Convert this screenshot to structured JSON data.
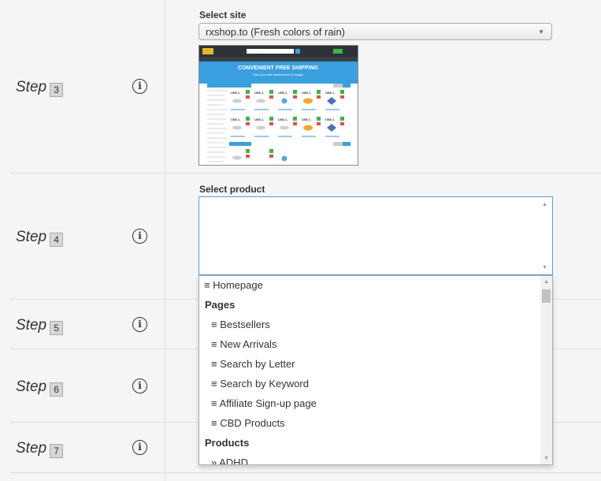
{
  "steps": [
    {
      "label": "Step",
      "number": "3"
    },
    {
      "label": "Step",
      "number": "4"
    },
    {
      "label": "Step",
      "number": "5"
    },
    {
      "label": "Step",
      "number": "6"
    },
    {
      "label": "Step",
      "number": "7"
    }
  ],
  "info_glyph": "i",
  "site": {
    "label": "Select site",
    "selected": "rxshop.to (Fresh colors of rain)",
    "arrow": "▼"
  },
  "preview": {
    "banner_title": "CONVENIENT FREE SHIPPING",
    "banner_sub": "Have your order delivered free of charge!",
    "price": "US$ 1.",
    "colors": {
      "header": "#2e3338",
      "banner": "#3aa0e0",
      "accent": "#3aa0e0",
      "green": "#3cb44a",
      "badge": "#d9534f"
    }
  },
  "product": {
    "label": "Select product",
    "scroll_up": "▲",
    "scroll_down": "▼"
  },
  "dropdown": {
    "items": [
      {
        "text": "≡ Homepage",
        "type": "item"
      },
      {
        "text": "Pages",
        "type": "group"
      },
      {
        "text": "≡ Bestsellers",
        "type": "sub"
      },
      {
        "text": "≡ New Arrivals",
        "type": "sub"
      },
      {
        "text": "≡ Search by Letter",
        "type": "sub"
      },
      {
        "text": "≡ Search by Keyword",
        "type": "sub"
      },
      {
        "text": "≡ Affiliate Sign-up page",
        "type": "sub"
      },
      {
        "text": "≡ CBD Products",
        "type": "sub"
      },
      {
        "text": "Products",
        "type": "group"
      },
      {
        "text": "» ADHD",
        "type": "sub"
      }
    ],
    "scroll_up": "▲",
    "scroll_down": "▼"
  }
}
